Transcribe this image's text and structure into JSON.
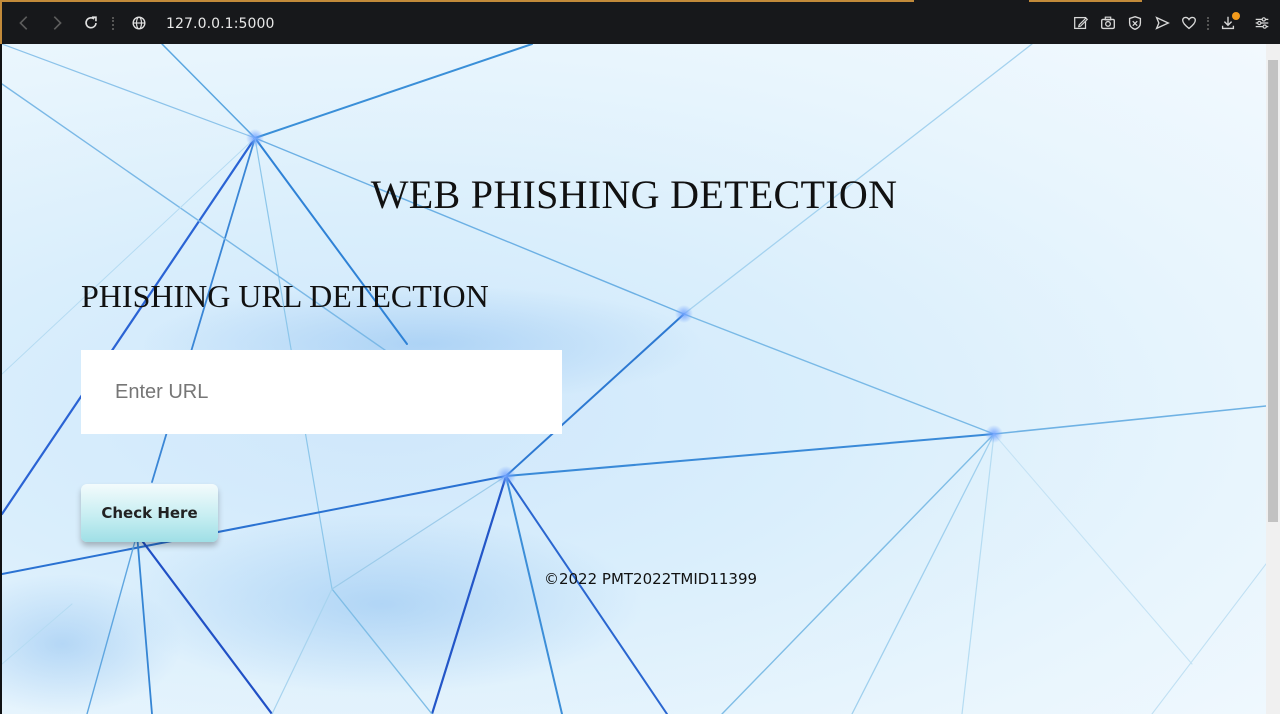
{
  "browser": {
    "url": "127.0.0.1:5000",
    "accent_color": "#c28a3a",
    "notification_color": "#f29a1c",
    "icons": {
      "back": "back-arrow-icon",
      "forward": "forward-arrow-icon",
      "reload": "reload-icon",
      "site_info": "globe-icon",
      "edit": "edit-icon",
      "snapshot": "camera-icon",
      "shield": "shield-icon",
      "send": "send-icon",
      "favorite": "heart-icon",
      "download": "download-icon",
      "settings": "easy-setup-icon"
    }
  },
  "page": {
    "title": "WEB PHISHING DETECTION",
    "section_title": "PHISHING URL DETECTION",
    "url_input": {
      "placeholder": "Enter URL",
      "value": ""
    },
    "check_button": "Check Here",
    "footer": "©2022 PMT2022TMID11399"
  }
}
